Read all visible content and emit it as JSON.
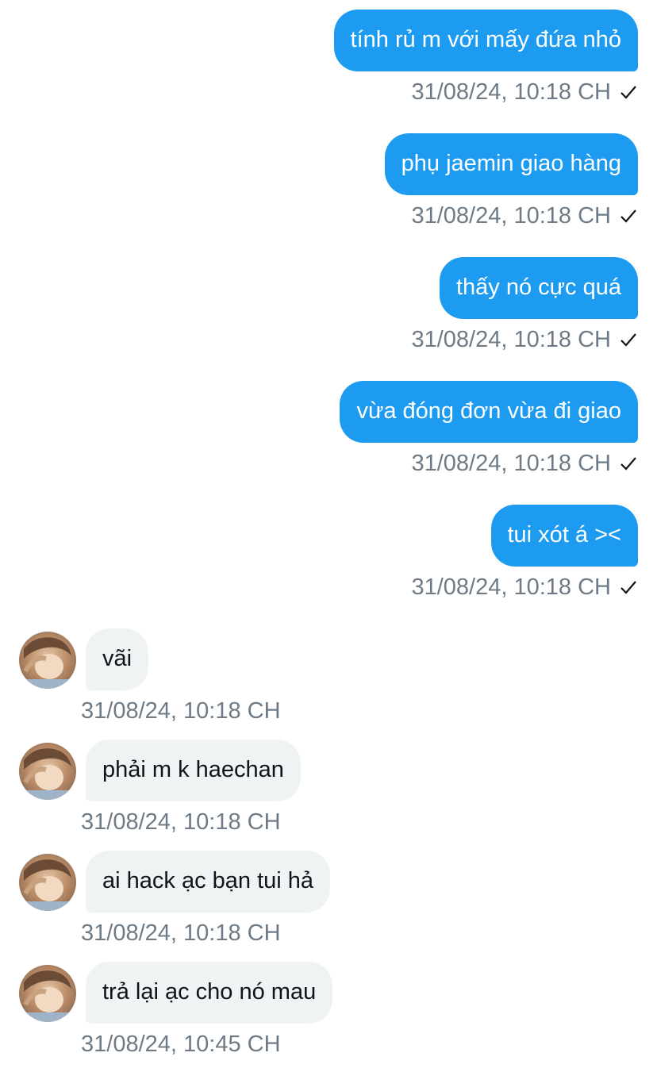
{
  "colors": {
    "outgoing_bubble": "#1d9bf0",
    "incoming_bubble": "#eff3f4",
    "meta_text": "#6e7b87"
  },
  "outgoing": [
    {
      "text": "tính rủ m với mấy đứa nhỏ",
      "time": "31/08/24, 10:18 CH",
      "status_icon": "check-icon"
    },
    {
      "text": "phụ jaemin giao hàng",
      "time": "31/08/24, 10:18 CH",
      "status_icon": "check-icon"
    },
    {
      "text": "thấy nó cực quá",
      "time": "31/08/24, 10:18 CH",
      "status_icon": "check-icon"
    },
    {
      "text": "vừa đóng đơn vừa đi giao",
      "time": "31/08/24, 10:18 CH",
      "status_icon": "check-icon"
    },
    {
      "text": "tui xót á ><",
      "time": "31/08/24, 10:18 CH",
      "status_icon": "check-icon"
    }
  ],
  "incoming": [
    {
      "text": "vãi",
      "time": "31/08/24, 10:18 CH",
      "avatar": "sender-avatar"
    },
    {
      "text": "phải m k haechan",
      "time": "31/08/24, 10:18 CH",
      "avatar": "sender-avatar"
    },
    {
      "text": "ai hack ạc bạn tui hả",
      "time": "31/08/24, 10:18 CH",
      "avatar": "sender-avatar"
    },
    {
      "text": "trả lại ạc cho nó mau",
      "time": "31/08/24, 10:45 CH",
      "avatar": "sender-avatar"
    }
  ]
}
